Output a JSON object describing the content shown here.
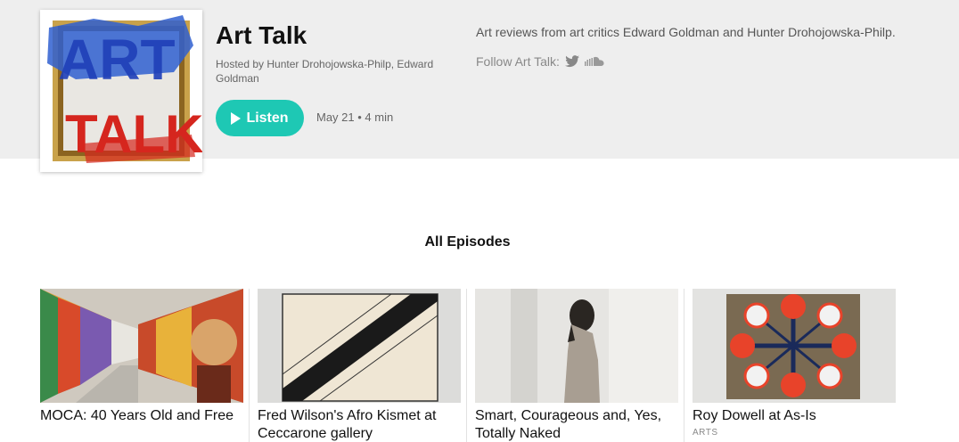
{
  "show": {
    "title": "Art Talk",
    "hosts": "Hosted by Hunter Drohojowska-Philp, Edward Goldman",
    "cover_alt": "ART TALK",
    "cover_text_top": "ART",
    "cover_text_bottom": "TALK",
    "listen_label": "Listen",
    "date": "May 21",
    "duration": "4 min",
    "meta": "May 21 • 4 min",
    "description": "Art reviews from art critics Edward Goldman and Hunter Drohojowska-Philp.",
    "follow_label": "Follow Art Talk:",
    "follow_icons": [
      "twitter-icon",
      "soundcloud-icon"
    ]
  },
  "episodes": {
    "heading": "All Episodes",
    "items": [
      {
        "title": "MOCA: 40 Years Old and Free",
        "category": ""
      },
      {
        "title": "Fred Wilson's Afro Kismet at Ceccarone gallery",
        "category": ""
      },
      {
        "title": "Smart, Courageous and, Yes, Totally Naked",
        "category": ""
      },
      {
        "title": "Roy Dowell at As-Is",
        "category": "ARTS"
      }
    ]
  },
  "colors": {
    "accent": "#1ec8b4",
    "hero_bg": "#eeeeee"
  }
}
